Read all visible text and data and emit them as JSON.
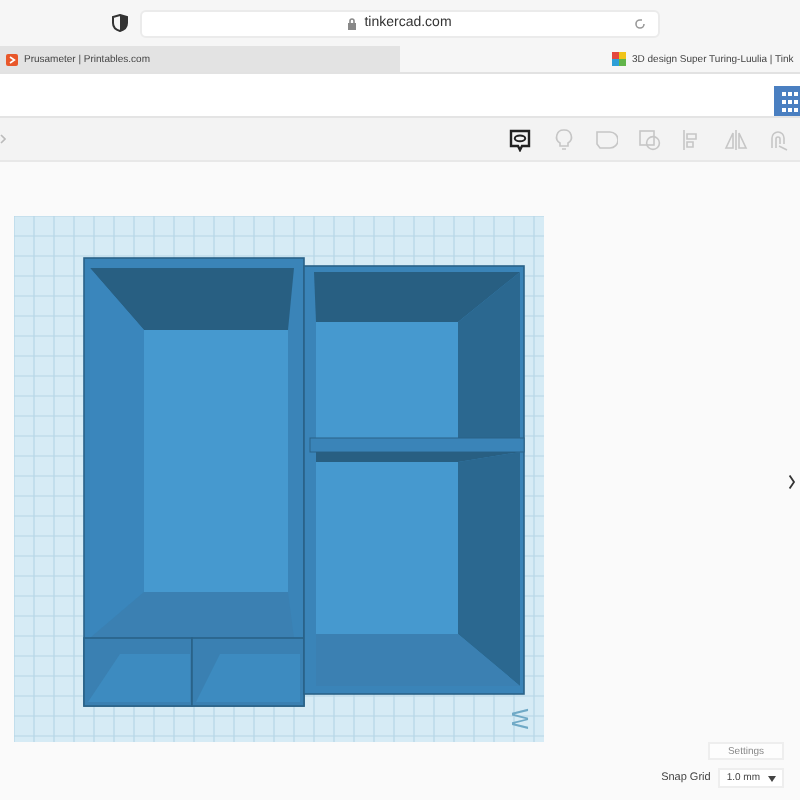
{
  "browser": {
    "url": "tinkercad.com",
    "tabs": [
      {
        "title": "Prusameter | Printables.com",
        "selected": false,
        "kind": "printables"
      },
      {
        "title": "3D design Super Turing-Luulia | Tink",
        "selected": true,
        "kind": "tinkercad"
      }
    ]
  },
  "tools": [
    {
      "kind": "note",
      "selected": true
    },
    {
      "kind": "bulb",
      "selected": false
    },
    {
      "kind": "shape",
      "selected": false
    },
    {
      "kind": "group",
      "selected": false
    },
    {
      "kind": "align",
      "selected": false
    },
    {
      "kind": "mirror",
      "selected": false
    },
    {
      "kind": "magnet",
      "selected": false
    }
  ],
  "workplane": {
    "label": "W"
  },
  "settings_button": "Settings",
  "snap_grid": {
    "label": "Snap Grid",
    "value": "1.0 mm"
  }
}
